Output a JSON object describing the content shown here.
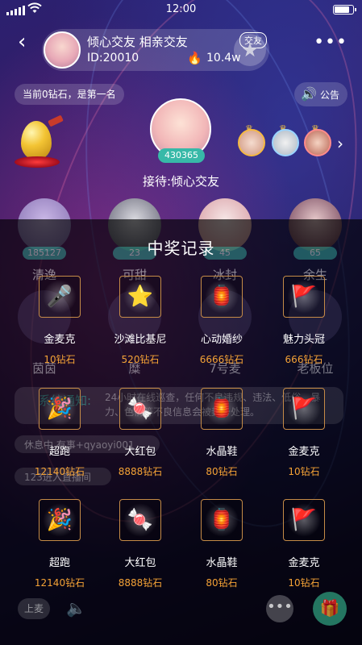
{
  "status_bar": {
    "time": "12:00"
  },
  "room": {
    "name": "倾心交友 相亲交友",
    "tag": "交友",
    "id": "ID:20010",
    "popularity": "10.4w"
  },
  "rank_text": "当前0钻石，是第一名",
  "notice_label": "公告",
  "host": {
    "number": "430365",
    "label": "接待:倾心交友"
  },
  "seats": [
    {
      "number": "185127",
      "name": "清逸"
    },
    {
      "number": "23",
      "name": "可甜"
    },
    {
      "number": "45",
      "name": "冰封"
    },
    {
      "number": "65",
      "name": "余生"
    }
  ],
  "seats_row2_names": [
    "茵茵",
    "糜",
    "7号麦",
    "老板位"
  ],
  "system_msg": {
    "title": "系统通知:",
    "text": "24小时在线巡查，任何不良违规、违法、低俗、暴力、色情等不良信息会被封号处理。"
  },
  "chat_lines": [
    "休息中 有事+qyaoyi001",
    "123进入直播间"
  ],
  "bottom": {
    "mic_label": "上麦"
  },
  "modal": {
    "title": "中奖记录",
    "prizes": [
      {
        "name": "金麦克",
        "price": "10钻石",
        "icon": "microphone-icon"
      },
      {
        "name": "沙滩比基尼",
        "price": "520钻石",
        "icon": "star-icon"
      },
      {
        "name": "心动婚纱",
        "price": "6666钻石",
        "icon": "lantern-icon"
      },
      {
        "name": "魅力头冠",
        "price": "666钻石",
        "icon": "flag-icon"
      },
      {
        "name": "超跑",
        "price": "12140钻石",
        "icon": "party-popper-icon"
      },
      {
        "name": "大红包",
        "price": "8888钻石",
        "icon": "candy-icon"
      },
      {
        "name": "水晶鞋",
        "price": "80钻石",
        "icon": "lantern-icon"
      },
      {
        "name": "金麦克",
        "price": "10钻石",
        "icon": "flag-icon"
      },
      {
        "name": "超跑",
        "price": "12140钻石",
        "icon": "party-popper-icon"
      },
      {
        "name": "大红包",
        "price": "8888钻石",
        "icon": "candy-icon"
      },
      {
        "name": "水晶鞋",
        "price": "80钻石",
        "icon": "lantern-icon"
      },
      {
        "name": "金麦克",
        "price": "10钻石",
        "icon": "flag-icon"
      }
    ]
  },
  "colors": {
    "accent_teal": "#37b9a8",
    "price_orange": "#f4a236",
    "prize_border": "#c58b47"
  }
}
